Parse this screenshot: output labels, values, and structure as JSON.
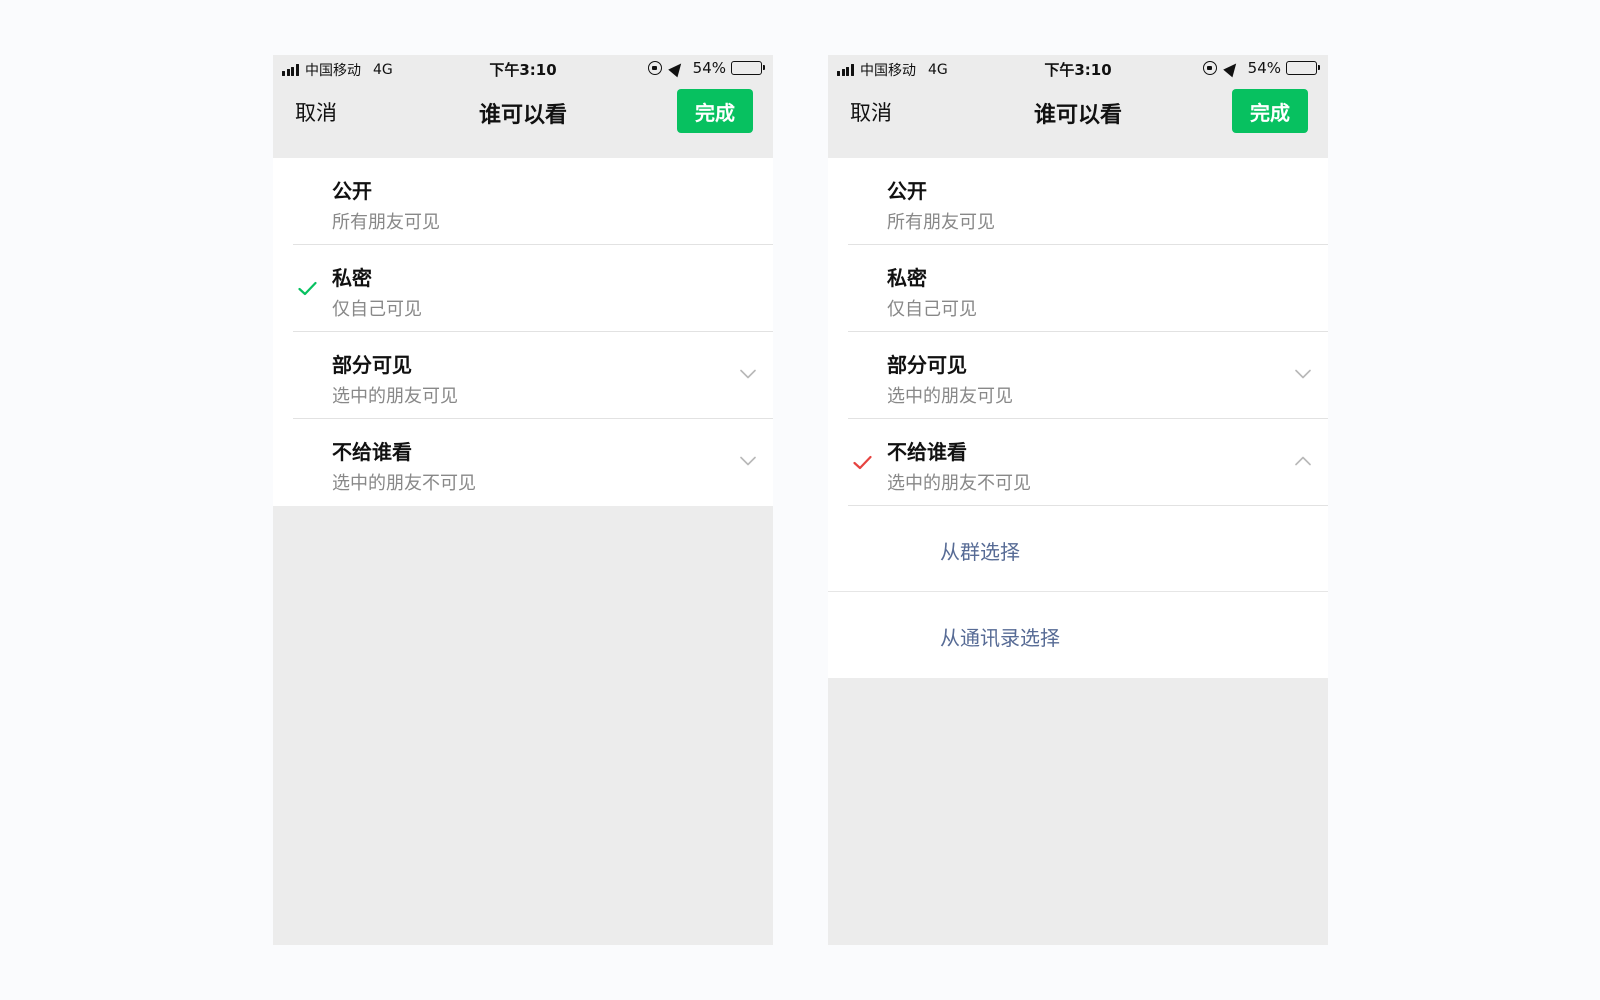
{
  "colors": {
    "accent": "#07c160",
    "link": "#576b95",
    "check_green": "#07c160",
    "check_red": "#e64340"
  },
  "status_bar": {
    "carrier": "中国移动",
    "network": "4G",
    "time": "下午3:10",
    "battery_percent": "54%",
    "battery_level": 0.54
  },
  "nav": {
    "cancel_label": "取消",
    "title": "谁可以看",
    "done_label": "完成"
  },
  "options": [
    {
      "title": "公开",
      "subtitle": "所有朋友可见"
    },
    {
      "title": "私密",
      "subtitle": "仅自己可见"
    },
    {
      "title": "部分可见",
      "subtitle": "选中的朋友可见"
    },
    {
      "title": "不给谁看",
      "subtitle": "选中的朋友不可见"
    }
  ],
  "screens": [
    {
      "selected_option": "私密",
      "check_icon": "check-icon",
      "expanded": ""
    },
    {
      "selected_option": "不给谁看",
      "check_icon": "check-icon",
      "expanded": "不给谁看"
    }
  ],
  "sub_options": {
    "from_group": "从群选择",
    "from_contacts": "从通讯录选择"
  }
}
